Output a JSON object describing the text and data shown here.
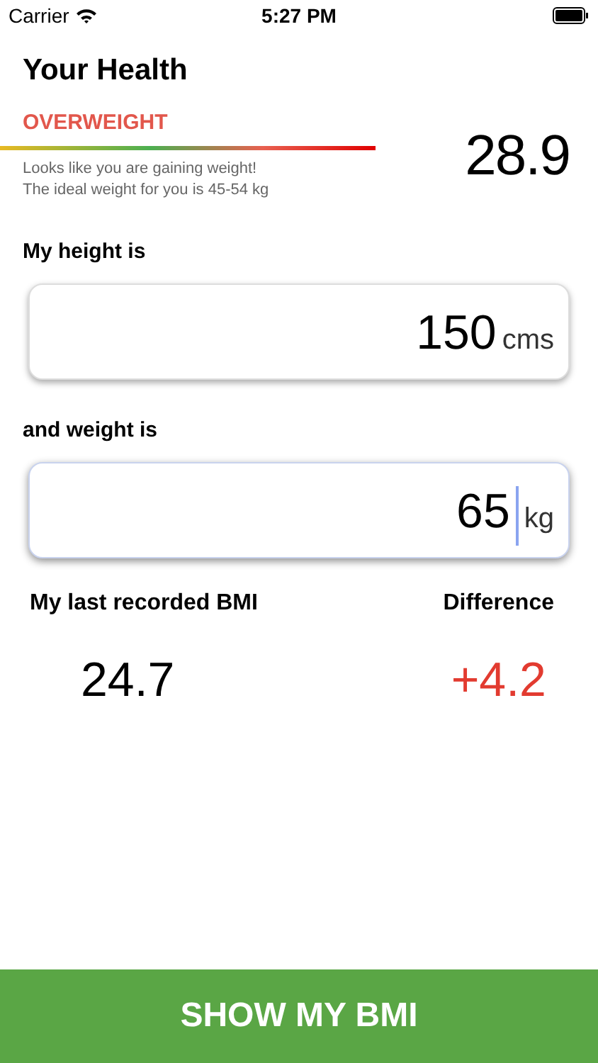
{
  "status_bar": {
    "carrier": "Carrier",
    "time": "5:27 PM"
  },
  "title": "Your Health",
  "category": {
    "label": "OVERWEIGHT",
    "message": "Looks like you are gaining weight!",
    "ideal": "The ideal weight for you is 45-54 kg"
  },
  "bmi": "28.9",
  "fields": [
    {
      "label": "My height is",
      "value": "150",
      "unit": "cms",
      "focused": false
    },
    {
      "label": "and weight is",
      "value": "65",
      "unit": "kg",
      "focused": true
    }
  ],
  "last": {
    "label": "My last recorded BMI",
    "value": "24.7"
  },
  "difference": {
    "label": "Difference",
    "value": "+4.2"
  },
  "button": "SHOW MY BMI"
}
